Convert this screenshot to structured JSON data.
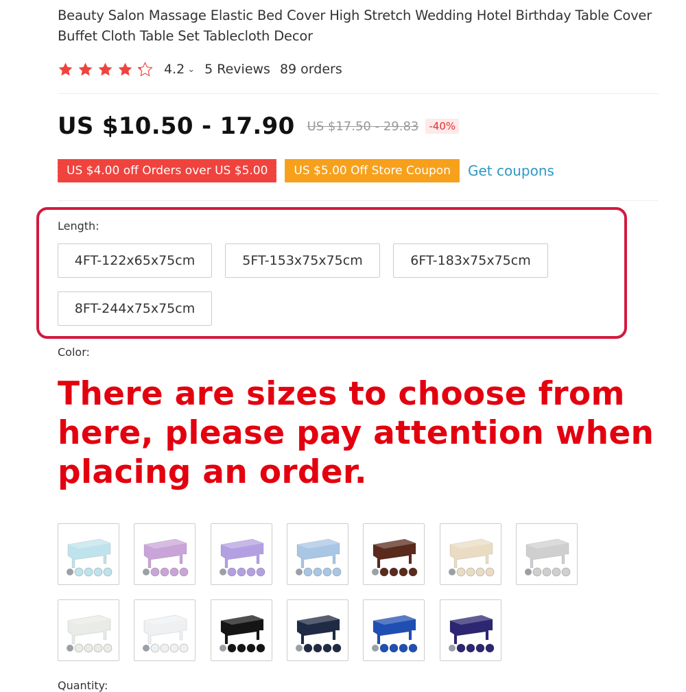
{
  "product": {
    "title": "Beauty Salon Massage Elastic Bed Cover High Stretch Wedding Hotel Birthday Table Cover Buffet Cloth Table Set Tablecloth Decor",
    "rating": "4.2",
    "rating_value": 4.2,
    "rating_max": 5,
    "reviews": "5 Reviews",
    "orders": "89 orders"
  },
  "price": {
    "current": "US $10.50 - 17.90",
    "original": "US $17.50 - 29.83",
    "discount": "-40%"
  },
  "coupons": {
    "items": [
      "US $4.00 off Orders over US $5.00",
      "US $5.00 Off Store Coupon"
    ],
    "get_label": "Get coupons"
  },
  "length": {
    "label": "Length:",
    "options": [
      "4FT-122x65x75cm",
      "5FT-153x75x75cm",
      "6FT-183x75x75cm",
      "8FT-244x75x75cm"
    ]
  },
  "color": {
    "label": "Color:",
    "swatches": [
      {
        "name": "light-blue",
        "hex": "#bfe3ec"
      },
      {
        "name": "violet",
        "hex": "#c9a4d8"
      },
      {
        "name": "lavender",
        "hex": "#b3a0e2"
      },
      {
        "name": "sky-blue",
        "hex": "#a9c6e4"
      },
      {
        "name": "brown",
        "hex": "#5a2a1c"
      },
      {
        "name": "beige",
        "hex": "#eadcc3"
      },
      {
        "name": "silver",
        "hex": "#cfcfcf"
      },
      {
        "name": "white",
        "hex": "#e8ebe6"
      },
      {
        "name": "white-2",
        "hex": "#eef0f2"
      },
      {
        "name": "black",
        "hex": "#151515"
      },
      {
        "name": "navy",
        "hex": "#1f2a44"
      },
      {
        "name": "royal-blue",
        "hex": "#1f4fb2"
      },
      {
        "name": "purple",
        "hex": "#2d2670"
      }
    ]
  },
  "notice": "There are sizes to choose from here, please pay attention when placing an order.",
  "quantity_label": "Quantity:",
  "colors": {
    "accent_red": "#e3000f",
    "highlight_border": "#d11a3f",
    "star": "#f0433e",
    "coupon_red": "#f0433e",
    "coupon_orange": "#f7a01c",
    "link_blue": "#2f97c4"
  }
}
